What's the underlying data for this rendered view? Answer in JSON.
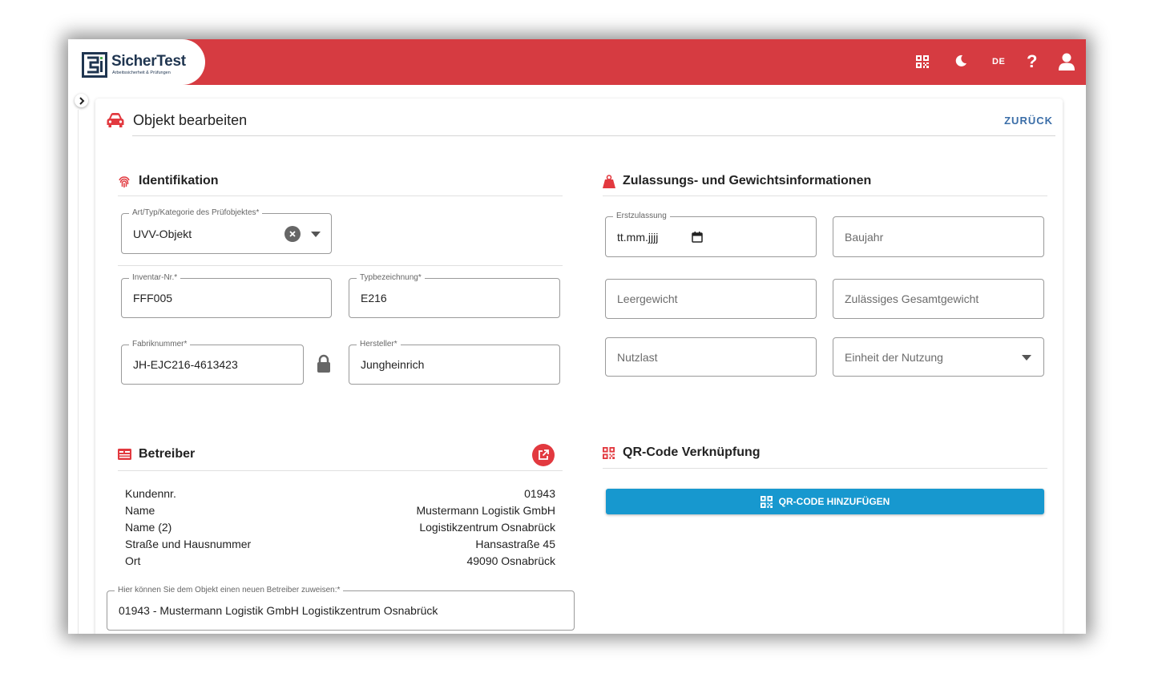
{
  "app": {
    "brand_name": "SicherTest",
    "brand_tagline": "Arbeitssicherheit & Prüfungen",
    "language": "DE",
    "help_label": "?"
  },
  "colors": {
    "topbar": "#d63b41",
    "accent_red": "#e2393f",
    "primary_blue": "#1798cf",
    "link_blue": "#3b6ea8",
    "logo_navy": "#1f3550"
  },
  "icons": {
    "topbar": [
      "qr-code-icon",
      "moon-icon",
      "help-icon",
      "user-icon"
    ],
    "sections": [
      "car-icon",
      "fingerprint-icon",
      "weight-icon",
      "id-card-icon",
      "qr-code-icon"
    ]
  },
  "page": {
    "title": "Objekt bearbeiten",
    "back_label": "ZURÜCK"
  },
  "identification": {
    "title": "Identifikation",
    "category": {
      "label": "Art/Typ/Kategorie des Prüfobjektes*",
      "value": "UVV-Objekt"
    },
    "inventory": {
      "label": "Inventar-Nr.*",
      "value": "FFF005"
    },
    "type_designation": {
      "label": "Typbezeichnung*",
      "value": "E216"
    },
    "serial": {
      "label": "Fabriknummer*",
      "value": "JH-EJC216-4613423"
    },
    "manufacturer": {
      "label": "Hersteller*",
      "value": "Jungheinrich"
    }
  },
  "registration": {
    "title": "Zulassungs- und Gewichtsinformationen",
    "first_registration": {
      "label": "Erstzulassung",
      "value": "tt.mm.jjjj"
    },
    "year_built": {
      "placeholder": "Baujahr"
    },
    "empty_weight": {
      "placeholder": "Leergewicht"
    },
    "gross_weight": {
      "placeholder": "Zulässiges Gesamtgewicht"
    },
    "payload": {
      "placeholder": "Nutzlast"
    },
    "usage_unit": {
      "placeholder": "Einheit der Nutzung"
    }
  },
  "operator": {
    "title": "Betreiber",
    "rows": [
      {
        "key": "Kundennr.",
        "value": "01943"
      },
      {
        "key": "Name",
        "value": "Mustermann Logistik GmbH"
      },
      {
        "key": "Name (2)",
        "value": "Logistikzentrum Osnabrück"
      },
      {
        "key": "Straße und Hausnummer",
        "value": "Hansastraße 45"
      },
      {
        "key": "Ort",
        "value": "49090 Osnabrück"
      }
    ],
    "assign": {
      "label": "Hier können Sie dem Objekt einen neuen Betreiber zuweisen:*",
      "value": "01943 - Mustermann Logistik GmbH Logistikzentrum Osnabrück"
    }
  },
  "qr": {
    "title": "QR-Code Verknüpfung",
    "add_label": "QR-CODE HINZUFÜGEN"
  }
}
